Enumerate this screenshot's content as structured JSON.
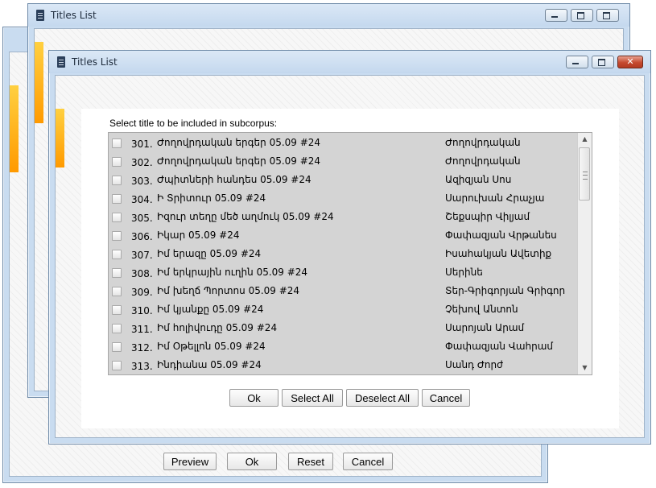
{
  "windows": {
    "back": {
      "buttons": {
        "preview": "Preview",
        "ok": "Ok",
        "reset": "Reset",
        "cancel": "Cancel"
      }
    },
    "middle": {
      "title": "Titles List"
    },
    "front": {
      "title": "Titles List",
      "instruction": "Select title to be included in subcorpus:",
      "buttons": {
        "ok": "Ok",
        "select_all": "Select All",
        "deselect_all": "Deselect All",
        "cancel": "Cancel"
      }
    }
  },
  "titles": [
    {
      "num": "301.",
      "title": "Ժողովրդական երգեր 05.09 #24",
      "author": "Ժողովրդական"
    },
    {
      "num": "302.",
      "title": "Ժողովրդական երգեր 05.09 #24",
      "author": "Ժողովրդական"
    },
    {
      "num": "303.",
      "title": "Ժպիտների հանդես 05.09 #24",
      "author": "Ազիզյան Սոս"
    },
    {
      "num": "304.",
      "title": "Ի Տրիտուր 05.09 #24",
      "author": "Սարուխան Հրաչյա"
    },
    {
      "num": "305.",
      "title": "Իզուր տեղը մեծ աղմուկ 05.09 #24",
      "author": "Շեքսպիր Վիլյամ"
    },
    {
      "num": "306.",
      "title": "Իկար 05.09 #24",
      "author": "Փափազյան Վրթանես"
    },
    {
      "num": "307.",
      "title": "Իմ երազը 05.09 #24",
      "author": "Իսահակյան Ավետիք"
    },
    {
      "num": "308.",
      "title": "Իմ երկրային ուղին 05.09 #24",
      "author": "Սերինե"
    },
    {
      "num": "309.",
      "title": "Իմ խեղճ Պորտոս 05.09 #24",
      "author": "Տեր-Գրիգորյան Գրիգոր"
    },
    {
      "num": "310.",
      "title": "Իմ կյանքը 05.09 #24",
      "author": "Չեխով Անտոն"
    },
    {
      "num": "311.",
      "title": "Իմ հոլիվուդը 05.09 #24",
      "author": "Սարոյան Արամ"
    },
    {
      "num": "312.",
      "title": "Իմ Օթելլոն 05.09 #24",
      "author": "Փափազյան Վահրամ"
    },
    {
      "num": "313.",
      "title": "Ինդիանա 05.09 #24",
      "author": "Սանդ Ժորժ"
    }
  ]
}
